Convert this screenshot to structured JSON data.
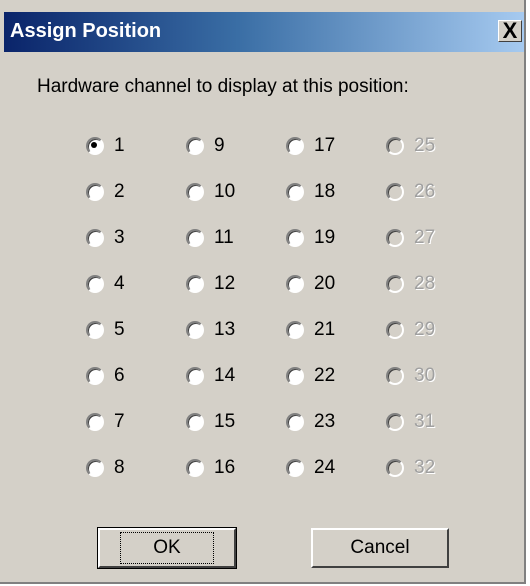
{
  "window": {
    "title": "Assign Position",
    "close_label": "X"
  },
  "prompt": "Hardware channel to display at this position:",
  "selected_channel": "1",
  "channels": [
    {
      "label": "1",
      "checked": true,
      "enabled": true
    },
    {
      "label": "2",
      "checked": false,
      "enabled": true
    },
    {
      "label": "3",
      "checked": false,
      "enabled": true
    },
    {
      "label": "4",
      "checked": false,
      "enabled": true
    },
    {
      "label": "5",
      "checked": false,
      "enabled": true
    },
    {
      "label": "6",
      "checked": false,
      "enabled": true
    },
    {
      "label": "7",
      "checked": false,
      "enabled": true
    },
    {
      "label": "8",
      "checked": false,
      "enabled": true
    },
    {
      "label": "9",
      "checked": false,
      "enabled": true
    },
    {
      "label": "10",
      "checked": false,
      "enabled": true
    },
    {
      "label": "11",
      "checked": false,
      "enabled": true
    },
    {
      "label": "12",
      "checked": false,
      "enabled": true
    },
    {
      "label": "13",
      "checked": false,
      "enabled": true
    },
    {
      "label": "14",
      "checked": false,
      "enabled": true
    },
    {
      "label": "15",
      "checked": false,
      "enabled": true
    },
    {
      "label": "16",
      "checked": false,
      "enabled": true
    },
    {
      "label": "17",
      "checked": false,
      "enabled": true
    },
    {
      "label": "18",
      "checked": false,
      "enabled": true
    },
    {
      "label": "19",
      "checked": false,
      "enabled": true
    },
    {
      "label": "20",
      "checked": false,
      "enabled": true
    },
    {
      "label": "21",
      "checked": false,
      "enabled": true
    },
    {
      "label": "22",
      "checked": false,
      "enabled": true
    },
    {
      "label": "23",
      "checked": false,
      "enabled": true
    },
    {
      "label": "24",
      "checked": false,
      "enabled": true
    },
    {
      "label": "25",
      "checked": false,
      "enabled": false
    },
    {
      "label": "26",
      "checked": false,
      "enabled": false
    },
    {
      "label": "27",
      "checked": false,
      "enabled": false
    },
    {
      "label": "28",
      "checked": false,
      "enabled": false
    },
    {
      "label": "29",
      "checked": false,
      "enabled": false
    },
    {
      "label": "30",
      "checked": false,
      "enabled": false
    },
    {
      "label": "31",
      "checked": false,
      "enabled": false
    },
    {
      "label": "32",
      "checked": false,
      "enabled": false
    }
  ],
  "buttons": {
    "ok_label": "OK",
    "cancel_label": "Cancel"
  },
  "colors": {
    "dialog_bg": "#d4d0c8",
    "titlebar_start": "#0a246a",
    "titlebar_end": "#a6caf0",
    "disabled_text": "#a0a0a0"
  }
}
